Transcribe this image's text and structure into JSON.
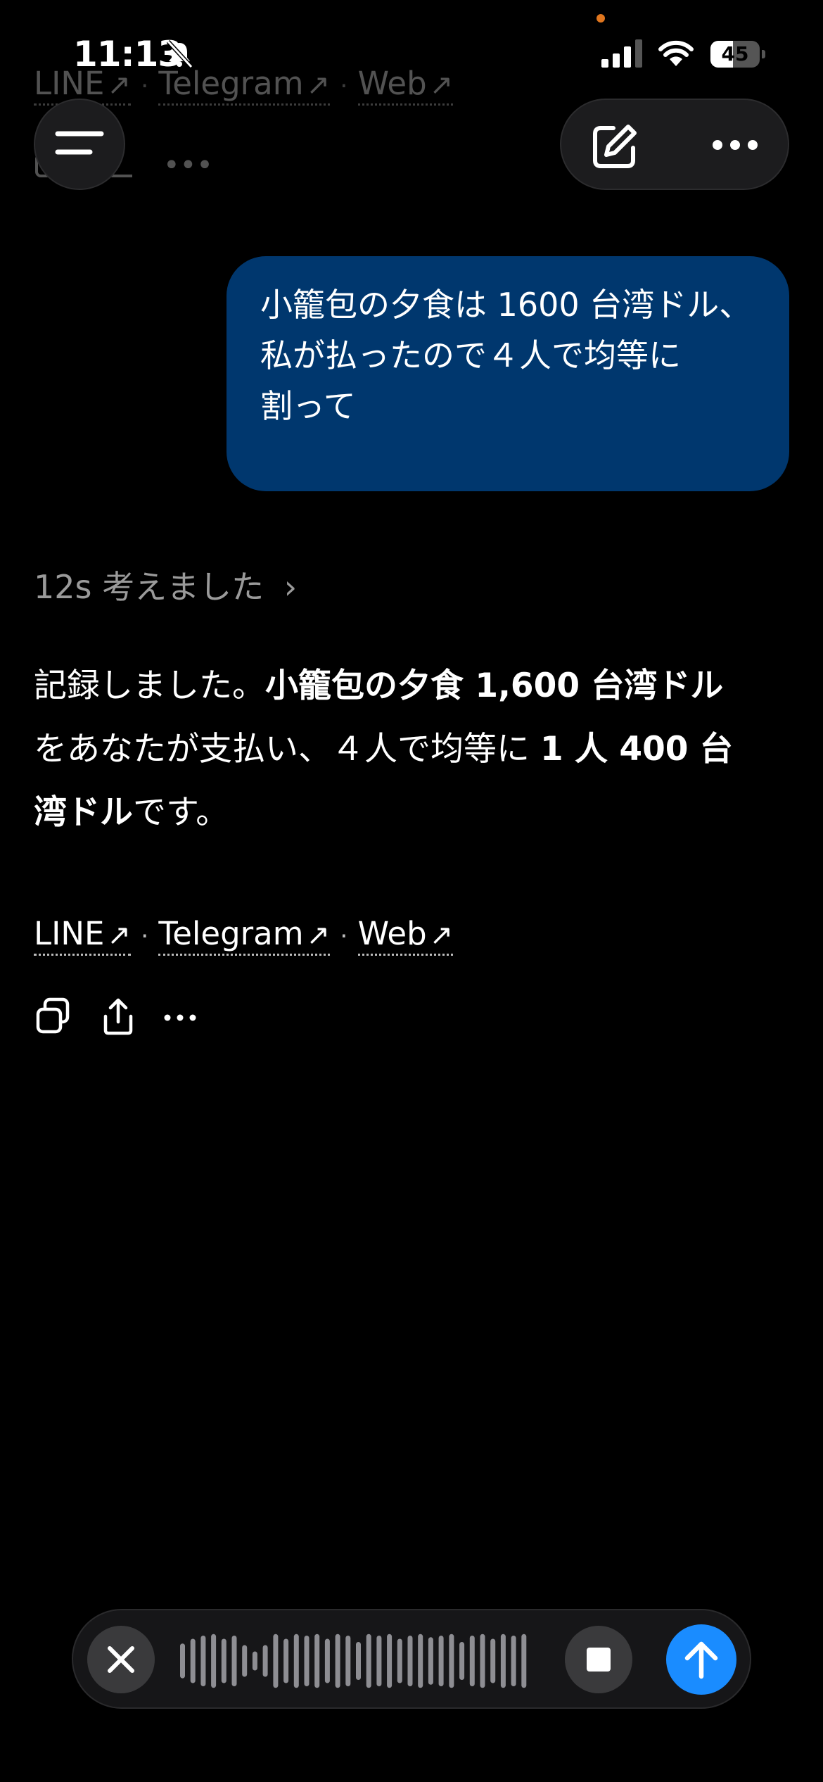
{
  "status_bar": {
    "time": "11:13",
    "battery": "45",
    "battery_level": 0.45
  },
  "header": {
    "links": [
      "LINE",
      "Telegram",
      "Web"
    ],
    "separator": "·"
  },
  "user_message": {
    "lines": [
      "小籠包の夕食は 1600 台湾ドル、",
      "私が払ったので４人で均等に",
      "割って"
    ]
  },
  "assistant": {
    "thought_label": "12s 考えました",
    "answer_segments": [
      {
        "text": "記録しました。",
        "bold": false
      },
      {
        "text": "小籠包の夕食 1,600 台湾ドル",
        "bold": true
      },
      {
        "text": "をあなたが支払い、４人で均等に ",
        "bold": false
      },
      {
        "text": "1 人 400 台湾ドル",
        "bold": true
      },
      {
        "text": "です。",
        "bold": false
      }
    ],
    "links": [
      "LINE",
      "Telegram",
      "Web"
    ],
    "actions": [
      "copy-icon",
      "share-icon",
      "more-icon"
    ]
  },
  "composer": {
    "wave_heights": [
      0.55,
      0.7,
      0.8,
      0.85,
      0.7,
      0.8,
      0.5,
      0.3,
      0.5,
      0.85,
      0.7,
      0.85,
      0.8,
      0.85,
      0.7,
      0.85,
      0.8,
      0.6,
      0.85,
      0.8,
      0.85,
      0.7,
      0.8,
      0.85,
      0.75,
      0.8,
      0.85,
      0.6,
      0.8,
      0.85,
      0.7,
      0.85,
      0.8,
      0.85
    ],
    "wave_color": "#8e8e93",
    "send_color": "#1a8cff"
  }
}
